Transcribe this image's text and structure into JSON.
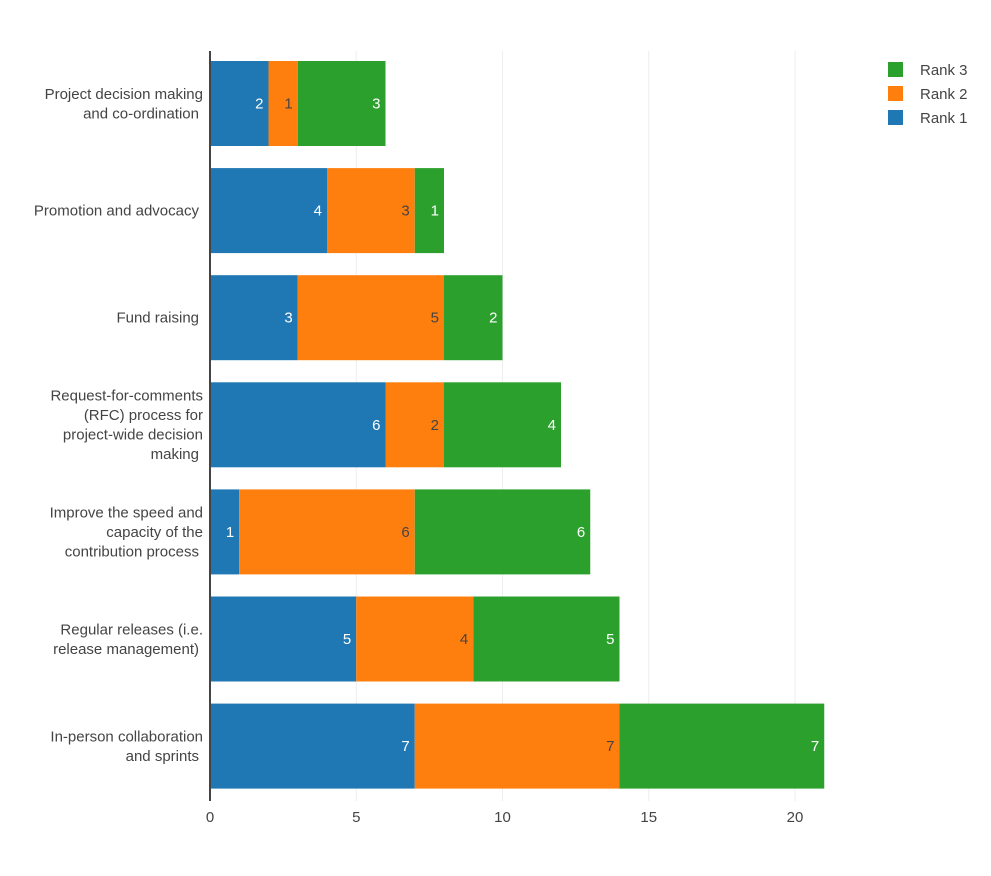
{
  "chart_data": {
    "type": "bar",
    "orientation": "horizontal",
    "stacked": true,
    "title": "",
    "xlabel": "",
    "ylabel": "",
    "xlim": [
      0,
      21.9
    ],
    "x_ticks": [
      0,
      5,
      10,
      15,
      20
    ],
    "grid": true,
    "legend_position": "top-right",
    "categories": [
      [
        "Project decision making",
        "and co-ordination"
      ],
      [
        "Promotion and advocacy"
      ],
      [
        "Fund raising"
      ],
      [
        "Request-for-comments",
        "(RFC) process for",
        "project-wide decision",
        "making"
      ],
      [
        "Improve the speed and",
        "capacity of the",
        "contribution process"
      ],
      [
        "Regular releases (i.e.",
        "release management)"
      ],
      [
        "In-person collaboration",
        "and sprints"
      ]
    ],
    "series": [
      {
        "name": "Rank 1",
        "color": "#1f77b4",
        "label_color": "#ffffff",
        "values": [
          2,
          4,
          3,
          6,
          1,
          5,
          7
        ]
      },
      {
        "name": "Rank 2",
        "color": "#ff7f0e",
        "label_color": "#444444",
        "values": [
          1,
          3,
          5,
          2,
          6,
          4,
          7
        ]
      },
      {
        "name": "Rank 3",
        "color": "#2ca02c",
        "label_color": "#ffffff",
        "values": [
          3,
          1,
          2,
          4,
          6,
          5,
          7
        ]
      }
    ],
    "legend_order": [
      "Rank 3",
      "Rank 2",
      "Rank 1"
    ]
  }
}
